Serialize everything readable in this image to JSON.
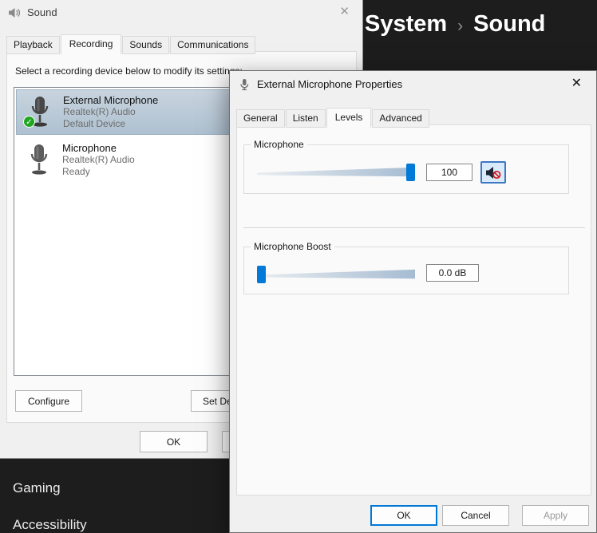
{
  "colors": {
    "accent": "#0078d7",
    "mute_red": "#d11a1a",
    "selection": "#aec1d0"
  },
  "settings": {
    "breadcrumb": {
      "parent": "System",
      "separator": "›",
      "current": "Sound"
    },
    "nav": {
      "gaming": "Gaming",
      "accessibility": "Accessibility"
    }
  },
  "sound_dialog": {
    "title": "Sound",
    "close": "✕",
    "tabs": {
      "playback": "Playback",
      "recording": "Recording",
      "sounds": "Sounds",
      "communications": "Communications"
    },
    "instruction": "Select a recording device below to modify its settings:",
    "devices": [
      {
        "name": "External Microphone",
        "driver": "Realtek(R) Audio",
        "status": "Default Device",
        "check": "✓"
      },
      {
        "name": "Microphone",
        "driver": "Realtek(R) Audio",
        "status": "Ready"
      }
    ],
    "buttons": {
      "configure": "Configure",
      "set_default": "Set Default",
      "ok": "OK"
    }
  },
  "props_dialog": {
    "title": "External Microphone Properties",
    "close": "✕",
    "tabs": {
      "general": "General",
      "listen": "Listen",
      "levels": "Levels",
      "advanced": "Advanced"
    },
    "microphone": {
      "label": "Microphone",
      "value": "100",
      "percent": 100
    },
    "boost": {
      "label": "Microphone Boost",
      "value": "0.0 dB",
      "percent": 0
    },
    "buttons": {
      "ok": "OK",
      "cancel": "Cancel",
      "apply": "Apply"
    }
  }
}
